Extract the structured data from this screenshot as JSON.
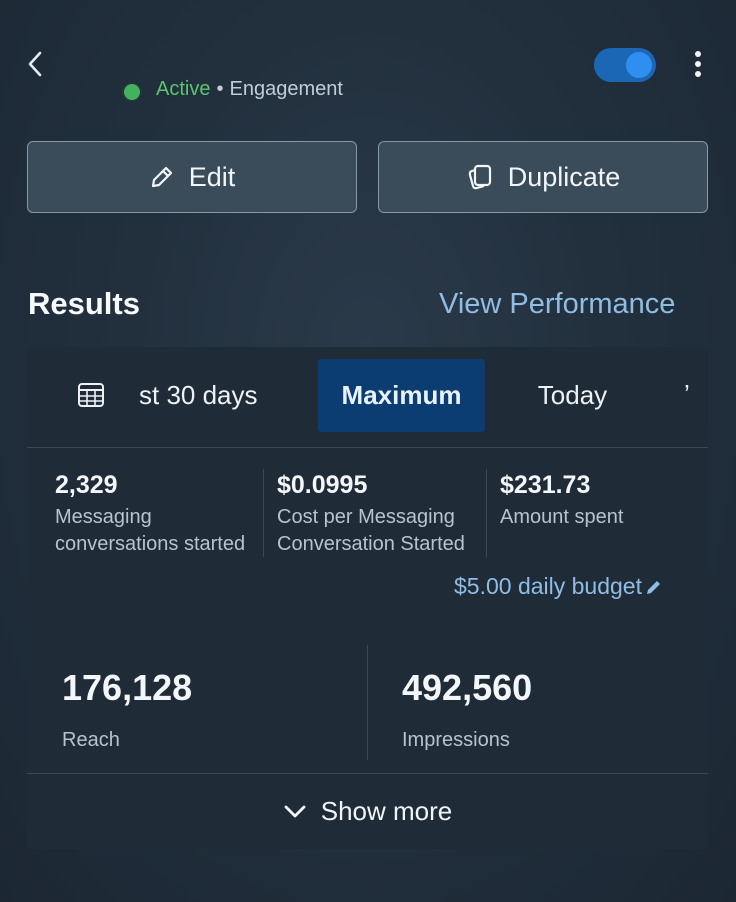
{
  "header": {
    "status": "Active",
    "separator": "•",
    "objective": "Engagement",
    "toggle_on": true,
    "accent_color": "#1c67b5",
    "status_color": "#42b35b"
  },
  "actions": {
    "edit_label": "Edit",
    "duplicate_label": "Duplicate"
  },
  "results": {
    "title": "Results",
    "view_performance": "View Performance",
    "tabs": [
      {
        "label": "st 30 days",
        "selected": false
      },
      {
        "label": "Maximum",
        "selected": true
      },
      {
        "label": "Today",
        "selected": false
      },
      {
        "label": "ʼ",
        "selected": false
      }
    ],
    "metrics": [
      {
        "value": "2,329",
        "label_line1": "Messaging",
        "label_line2": "conversations started"
      },
      {
        "value": "$0.0995",
        "label_line1": "Cost per Messaging",
        "label_line2": "Conversation Started"
      },
      {
        "value": "$231.73",
        "label_line1": "Amount spent",
        "label_line2": ""
      }
    ],
    "budget": "$5.00 daily budget",
    "reach": {
      "value": "176,128",
      "label": "Reach"
    },
    "impressions": {
      "value": "492,560",
      "label": "Impressions"
    },
    "show_more": "Show more"
  }
}
